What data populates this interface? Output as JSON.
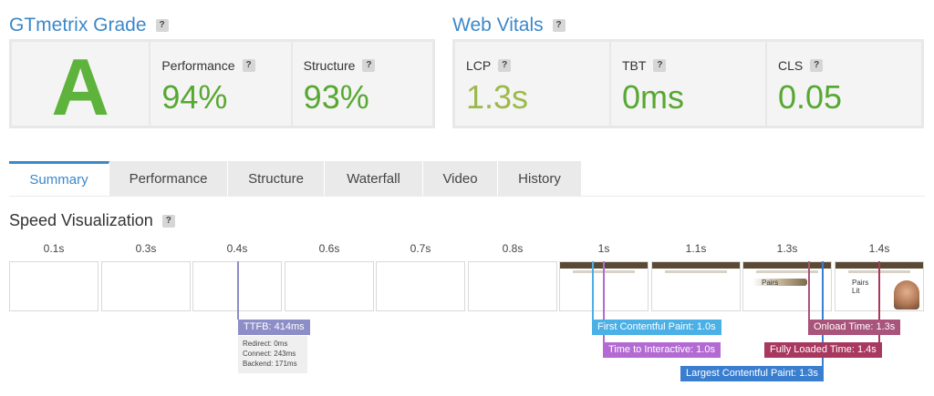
{
  "gtmetrix": {
    "title": "GTmetrix Grade",
    "grade": "A",
    "performance_label": "Performance",
    "performance_value": "94%",
    "structure_label": "Structure",
    "structure_value": "93%"
  },
  "web_vitals": {
    "title": "Web Vitals",
    "lcp_label": "LCP",
    "lcp_value": "1.3s",
    "tbt_label": "TBT",
    "tbt_value": "0ms",
    "cls_label": "CLS",
    "cls_value": "0.05"
  },
  "help_glyph": "?",
  "tabs": [
    "Summary",
    "Performance",
    "Structure",
    "Waterfall",
    "Video",
    "History"
  ],
  "active_tab": "Summary",
  "speed_viz": {
    "title": "Speed Visualization",
    "times": [
      "0.1s",
      "0.3s",
      "0.4s",
      "0.6s",
      "0.7s",
      "0.8s",
      "1s",
      "1.1s",
      "1.3s",
      "1.4s"
    ],
    "ttfb": "TTFB: 414ms",
    "ttfb_details": [
      "Redirect: 0ms",
      "Connect: 243ms",
      "Backend: 171ms"
    ],
    "fcp": "First Contentful Paint: 1.0s",
    "tti": "Time to Interactive: 1.0s",
    "lcp": "Largest Contentful Paint: 1.3s",
    "onload": "Onload Time: 1.3s",
    "fully_loaded": "Fully Loaded Time: 1.4s",
    "frame_text_pairs": "Pairs",
    "frame_text_lit": "Lit"
  },
  "colors": {
    "accent": "#3b88c9",
    "grade_green": "#5db33b",
    "value_green": "#57a832",
    "lcp_green": "#9bba4a",
    "ttfb": "#8d8dc7",
    "fcp": "#4ab0e6",
    "tti": "#b36ad3",
    "lcp_marker": "#3a7ed0",
    "onload": "#a9547a",
    "fully_loaded": "#a8385f"
  }
}
